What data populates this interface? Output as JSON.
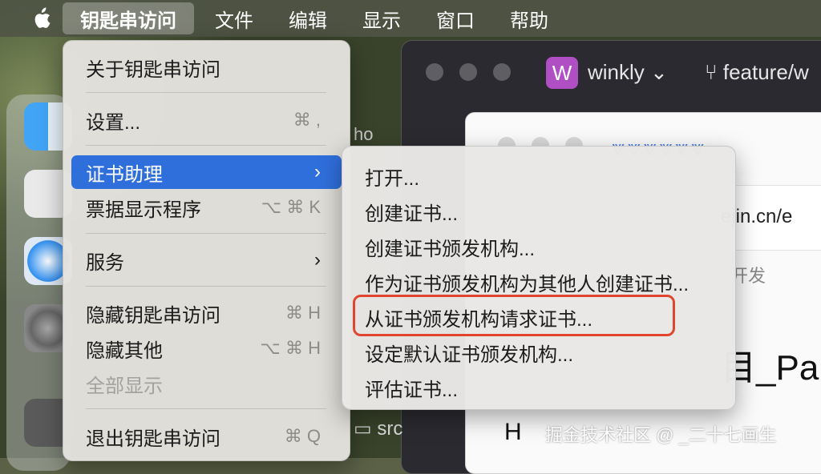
{
  "menubar": {
    "app_name": "钥匙串访问",
    "items": [
      "文件",
      "编辑",
      "显示",
      "窗口",
      "帮助"
    ]
  },
  "app_menu": {
    "about": "关于钥匙串访问",
    "settings": {
      "label": "设置...",
      "shortcut": "⌘ ,"
    },
    "cert_assistant": {
      "label": "证书助理",
      "arrow": "›"
    },
    "ticket_viewer": {
      "label": "票据显示程序",
      "shortcut": "⌥ ⌘ K"
    },
    "services": {
      "label": "服务",
      "arrow": "›"
    },
    "hide_app": {
      "label": "隐藏钥匙串访问",
      "shortcut": "⌘ H"
    },
    "hide_others": {
      "label": "隐藏其他",
      "shortcut": "⌥ ⌘ H"
    },
    "show_all": "全部显示",
    "quit": {
      "label": "退出钥匙串访问",
      "shortcut": "⌘ Q"
    }
  },
  "submenu": {
    "items": [
      "打开...",
      "创建证书...",
      "创建证书颁发机构...",
      "作为证书颁发机构为其他人创建证书...",
      "从证书颁发机构请求证书...",
      "设定默认证书颁发机构...",
      "评估证书..."
    ]
  },
  "background": {
    "project": "winkly",
    "project_initial": "W",
    "branch": "feature/w",
    "side_label": "ho",
    "folder": "src",
    "url": "ejin.cn/e",
    "nav_text": "开发",
    "heading": "目_Pa",
    "h_char": "H"
  },
  "watermark": "掘金技术社区 @ _二十七画生",
  "colors": {
    "highlight": "#2f6fdc",
    "annotation": "#e0452f"
  }
}
